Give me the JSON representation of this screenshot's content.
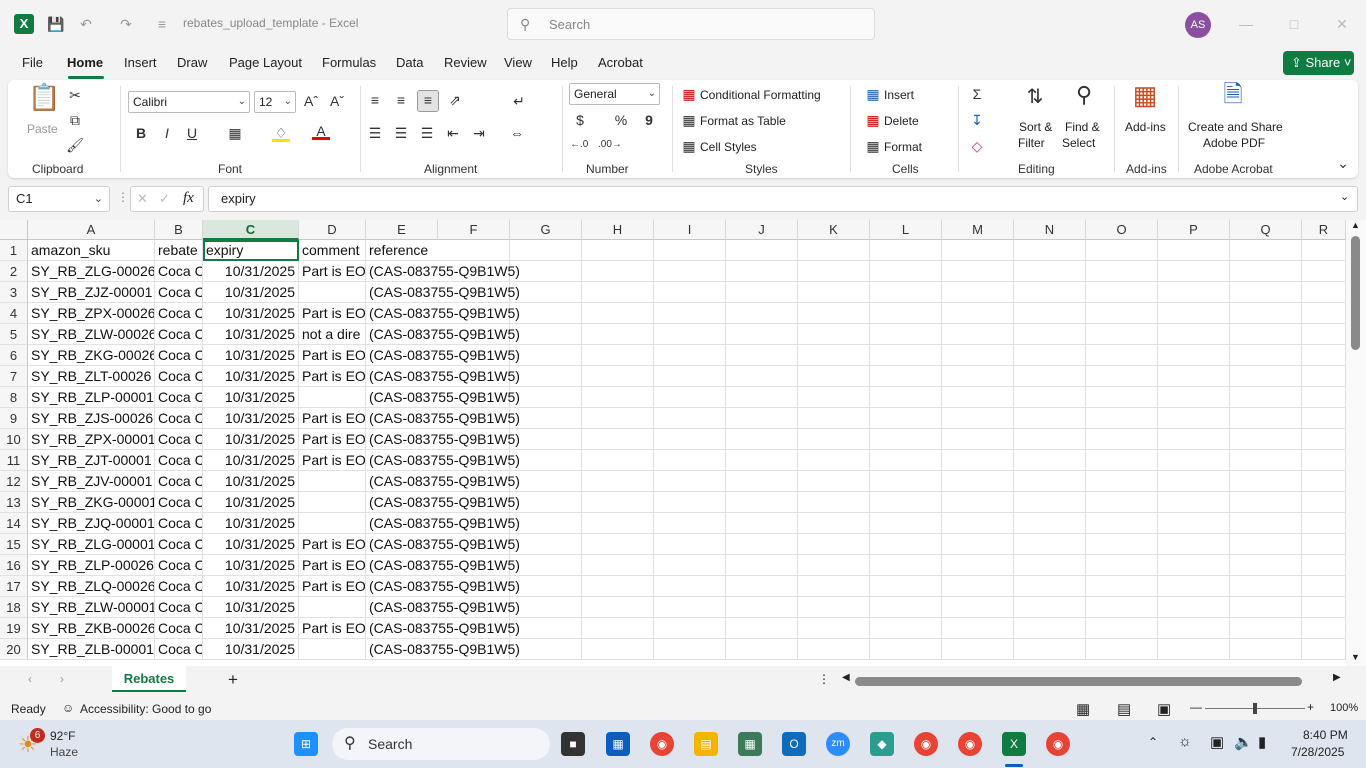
{
  "titlebar": {
    "doc_title": "rebates_upload_template  -  Excel",
    "search_placeholder": "Search",
    "avatar_initials": "AS"
  },
  "menu": [
    "File",
    "Home",
    "Insert",
    "Draw",
    "Page Layout",
    "Formulas",
    "Data",
    "Review",
    "View",
    "Help",
    "Acrobat"
  ],
  "share_label": "Share",
  "ribbon": {
    "clipboard": {
      "paste": "Paste",
      "label": "Clipboard"
    },
    "font": {
      "name": "Calibri",
      "size": "12",
      "bold": "B",
      "italic": "I",
      "underline": "U",
      "label": "Font"
    },
    "alignment": {
      "label": "Alignment"
    },
    "number": {
      "format": "General",
      "currency": "$",
      "percent": "%",
      "comma": "9",
      "label": "Number"
    },
    "styles": {
      "cond": "Conditional Formatting",
      "table": "Format as Table",
      "cell": "Cell Styles",
      "label": "Styles"
    },
    "cells": {
      "insert": "Insert",
      "delete": "Delete",
      "format": "Format",
      "label": "Cells"
    },
    "editing": {
      "sort1": "Sort &",
      "sort2": "Filter",
      "find1": "Find &",
      "find2": "Select",
      "label": "Editing"
    },
    "addins": {
      "btn": "Add-ins",
      "label": "Add-ins"
    },
    "acrobat": {
      "btn1": "Create and Share",
      "btn2": "Adobe PDF",
      "label": "Adobe Acrobat"
    }
  },
  "formula_bar": {
    "name_box": "C1",
    "fx": "fx",
    "value": "expiry"
  },
  "columns": [
    "A",
    "B",
    "C",
    "D",
    "E",
    "F",
    "G",
    "H",
    "I",
    "J",
    "K",
    "L",
    "M",
    "N",
    "O",
    "P",
    "Q",
    "R"
  ],
  "header_row": [
    "amazon_sku",
    "rebate",
    "expiry",
    "comment",
    "reference"
  ],
  "rows": [
    [
      "SY_RB_ZLG-00026",
      "Coca C",
      "10/31/2025",
      "Part is EO",
      "(CAS-083755-Q9B1W5)"
    ],
    [
      "SY_RB_ZJZ-00001",
      "Coca C",
      "10/31/2025",
      "",
      "(CAS-083755-Q9B1W5)"
    ],
    [
      "SY_RB_ZPX-00026",
      "Coca C",
      "10/31/2025",
      "Part is EO",
      "(CAS-083755-Q9B1W5)"
    ],
    [
      "SY_RB_ZLW-00026",
      "Coca C",
      "10/31/2025",
      "not a dire",
      "(CAS-083755-Q9B1W5)"
    ],
    [
      "SY_RB_ZKG-00026",
      "Coca C",
      "10/31/2025",
      "Part is EO",
      "(CAS-083755-Q9B1W5)"
    ],
    [
      "SY_RB_ZLT-00026",
      "Coca C",
      "10/31/2025",
      "Part is EO",
      "(CAS-083755-Q9B1W5)"
    ],
    [
      "SY_RB_ZLP-00001",
      "Coca C",
      "10/31/2025",
      "",
      "(CAS-083755-Q9B1W5)"
    ],
    [
      "SY_RB_ZJS-00026",
      "Coca C",
      "10/31/2025",
      "Part is EO",
      "(CAS-083755-Q9B1W5)"
    ],
    [
      "SY_RB_ZPX-00001",
      "Coca C",
      "10/31/2025",
      "Part is EO",
      "(CAS-083755-Q9B1W5)"
    ],
    [
      "SY_RB_ZJT-00001",
      "Coca C",
      "10/31/2025",
      "Part is EO",
      "(CAS-083755-Q9B1W5)"
    ],
    [
      "SY_RB_ZJV-00001",
      "Coca C",
      "10/31/2025",
      "",
      "(CAS-083755-Q9B1W5)"
    ],
    [
      "SY_RB_ZKG-00001",
      "Coca C",
      "10/31/2025",
      "",
      "(CAS-083755-Q9B1W5)"
    ],
    [
      "SY_RB_ZJQ-00001",
      "Coca C",
      "10/31/2025",
      "",
      "(CAS-083755-Q9B1W5)"
    ],
    [
      "SY_RB_ZLG-00001",
      "Coca C",
      "10/31/2025",
      "Part is EO",
      "(CAS-083755-Q9B1W5)"
    ],
    [
      "SY_RB_ZLP-00026",
      "Coca C",
      "10/31/2025",
      "Part is EO",
      "(CAS-083755-Q9B1W5)"
    ],
    [
      "SY_RB_ZLQ-00026",
      "Coca C",
      "10/31/2025",
      "Part is EO",
      "(CAS-083755-Q9B1W5)"
    ],
    [
      "SY_RB_ZLW-00001",
      "Coca C",
      "10/31/2025",
      "",
      "(CAS-083755-Q9B1W5)"
    ],
    [
      "SY_RB_ZKB-00026",
      "Coca C",
      "10/31/2025",
      "Part is EO",
      "(CAS-083755-Q9B1W5)"
    ],
    [
      "SY_RB_ZLB-00001",
      "Coca C",
      "10/31/2025",
      "",
      "(CAS-083755-Q9B1W5)"
    ]
  ],
  "sheet_tab": "Rebates",
  "status": {
    "ready": "Ready",
    "accessibility": "Accessibility: Good to go",
    "zoom": "100%"
  },
  "taskbar": {
    "weather_temp": "92°F",
    "weather_desc": "Haze",
    "weather_badge": "6",
    "search": "Search",
    "time": "8:40 PM",
    "date": "7/28/2025"
  },
  "colors": {
    "accent": "#107c41",
    "selected_header": "#d8e8dc"
  }
}
